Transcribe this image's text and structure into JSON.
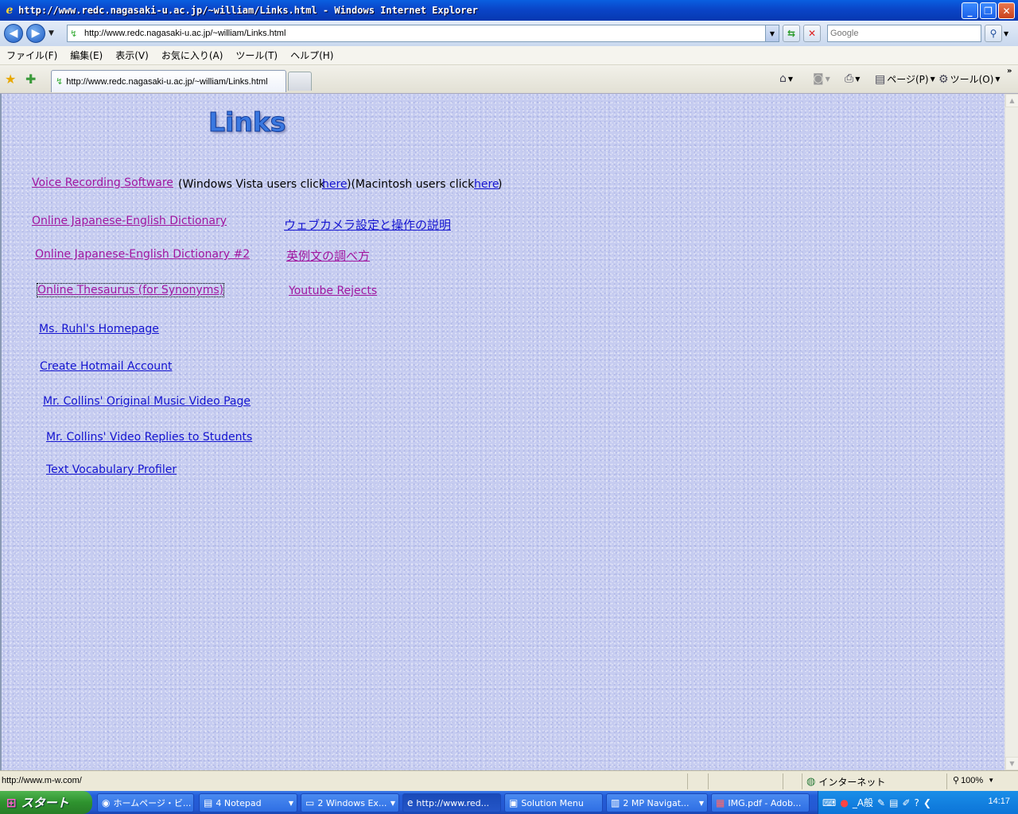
{
  "window": {
    "title": "http://www.redc.nagasaki-u.ac.jp/~william/Links.html - Windows Internet Explorer"
  },
  "address_bar": {
    "url": "http://www.redc.nagasaki-u.ac.jp/~william/Links.html",
    "search_placeholder": "Google"
  },
  "menu": {
    "items": [
      "ファイル(F)",
      "編集(E)",
      "表示(V)",
      "お気に入り(A)",
      "ツール(T)",
      "ヘルプ(H)"
    ]
  },
  "tabs": {
    "active_label": "http://www.redc.nagasaki-u.ac.jp/~william/Links.html"
  },
  "command_bar": {
    "page_label": "ページ(P)",
    "tools_label": "ツール(O)"
  },
  "page": {
    "heading": "Links",
    "voice_recording": "Voice Recording Software",
    "vista_prefix": "(Windows Vista users click ",
    "vista_link": "here",
    "mac_prefix": ")(Macintosh users click ",
    "mac_link": "here",
    "mac_suffix": ")",
    "left_links": [
      "Online Japanese-English Dictionary",
      "Online Japanese-English Dictionary #2",
      "Online Thesaurus (for Synonyms)",
      "Ms. Ruhl's Homepage",
      "Create Hotmail Account",
      "Mr. Collins' Original Music Video Page",
      "Mr. Collins' Video Replies to Students",
      "Text Vocabulary Profiler"
    ],
    "right_links": [
      "ウェブカメラ設定と操作の説明",
      "英例文の調べ方",
      "Youtube Rejects"
    ],
    "colors": {
      "visited": "#a016a0",
      "unvisited": "#1414d0",
      "background": "#c6ccf0"
    }
  },
  "status_bar": {
    "text": "http://www.m-w.com/",
    "zone": "インターネット",
    "zoom": "100%"
  },
  "taskbar": {
    "start_label": "スタート",
    "tasks": [
      "ホームページ・ビ...",
      "4 Notepad",
      "2 Windows Ex...",
      "http://www.red...",
      "Solution Menu",
      "2 MP Navigat...",
      "IMG.pdf - Adob..."
    ],
    "tray_text": "_A般",
    "clock": "14:17"
  }
}
